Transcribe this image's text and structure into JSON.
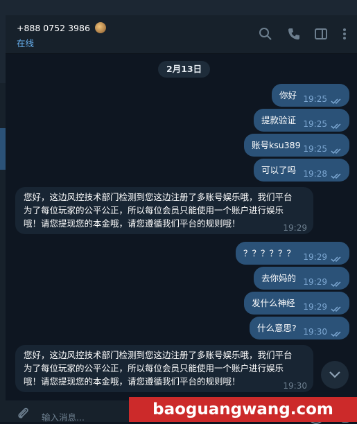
{
  "header": {
    "contact_name": "+888 0752 3986",
    "status": "在线"
  },
  "date_separator": "2月13日",
  "messages": [
    {
      "dir": "out",
      "text": "你好",
      "time": "19:25"
    },
    {
      "dir": "out",
      "text": "提款验证",
      "time": "19:25"
    },
    {
      "dir": "out",
      "text": "账号ksu389",
      "time": "19:25"
    },
    {
      "dir": "out",
      "text": "可以了吗",
      "time": "19:28"
    },
    {
      "dir": "in",
      "lines": [
        "您好，这边风控技术部门检测到您这边注册了多账号娱乐哦，我们平台",
        "为了每位玩家的公平公正，所以每位会员只能使用一个账户进行娱乐",
        "哦！请您提现您的本金哦，请您遵循我们平台的规则哦！"
      ],
      "time": "19:29"
    },
    {
      "dir": "out",
      "text": "？？？？？？",
      "time": "19:29"
    },
    {
      "dir": "out",
      "text": "去你妈的",
      "time": "19:29"
    },
    {
      "dir": "out",
      "text": "发什么神经",
      "time": "19:29"
    },
    {
      "dir": "out",
      "text": "什么意思?",
      "time": "19:30"
    },
    {
      "dir": "in",
      "lines": [
        "您好，这边风控技术部门检测到您这边注册了多账号娱乐哦，我们平台",
        "为了每位玩家的公平公正，所以每位会员只能使用一个账户进行娱乐",
        "哦！请您提现您的本金哦，请您遵循我们平台的规则哦！"
      ],
      "time": "19:30"
    }
  ],
  "composer": {
    "placeholder": "输入消息..."
  },
  "watermark": "baoguangwang.com",
  "icons": {
    "search": "search-icon",
    "call": "phone-icon",
    "sidebar": "sidebar-panel-icon",
    "more": "more-vertical-icon",
    "attach": "paperclip-icon",
    "emoji": "emoji-icon",
    "mic": "microphone-icon",
    "scroll": "chevron-down-icon",
    "read": "double-check-icon"
  },
  "colors": {
    "background": "#0e1621",
    "outgoing_bubble": "#2b5278",
    "incoming_bubble": "#182533",
    "status_accent": "#6ab3f3",
    "watermark_bg": "#cc2a2a"
  }
}
